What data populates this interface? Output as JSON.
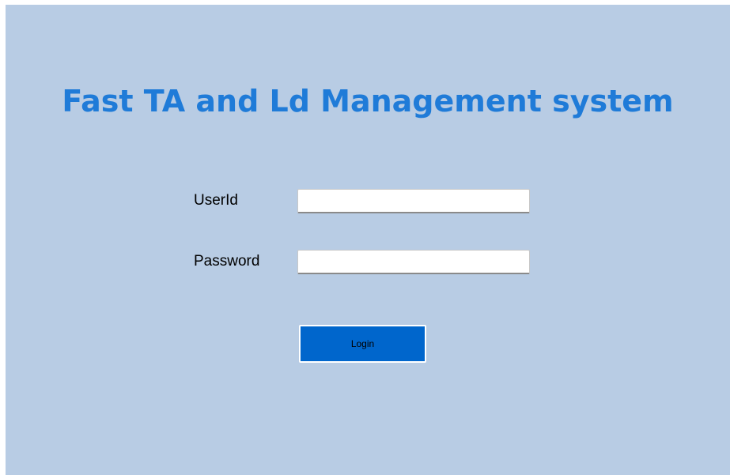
{
  "app": {
    "title": "Fast TA and Ld Management system"
  },
  "form": {
    "userid_label": "UserId",
    "userid_value": "",
    "password_label": "Password",
    "password_value": "",
    "login_label": "Login"
  },
  "colors": {
    "background": "#b8cce4",
    "title": "#1f7bd8",
    "button": "#0066cc"
  }
}
